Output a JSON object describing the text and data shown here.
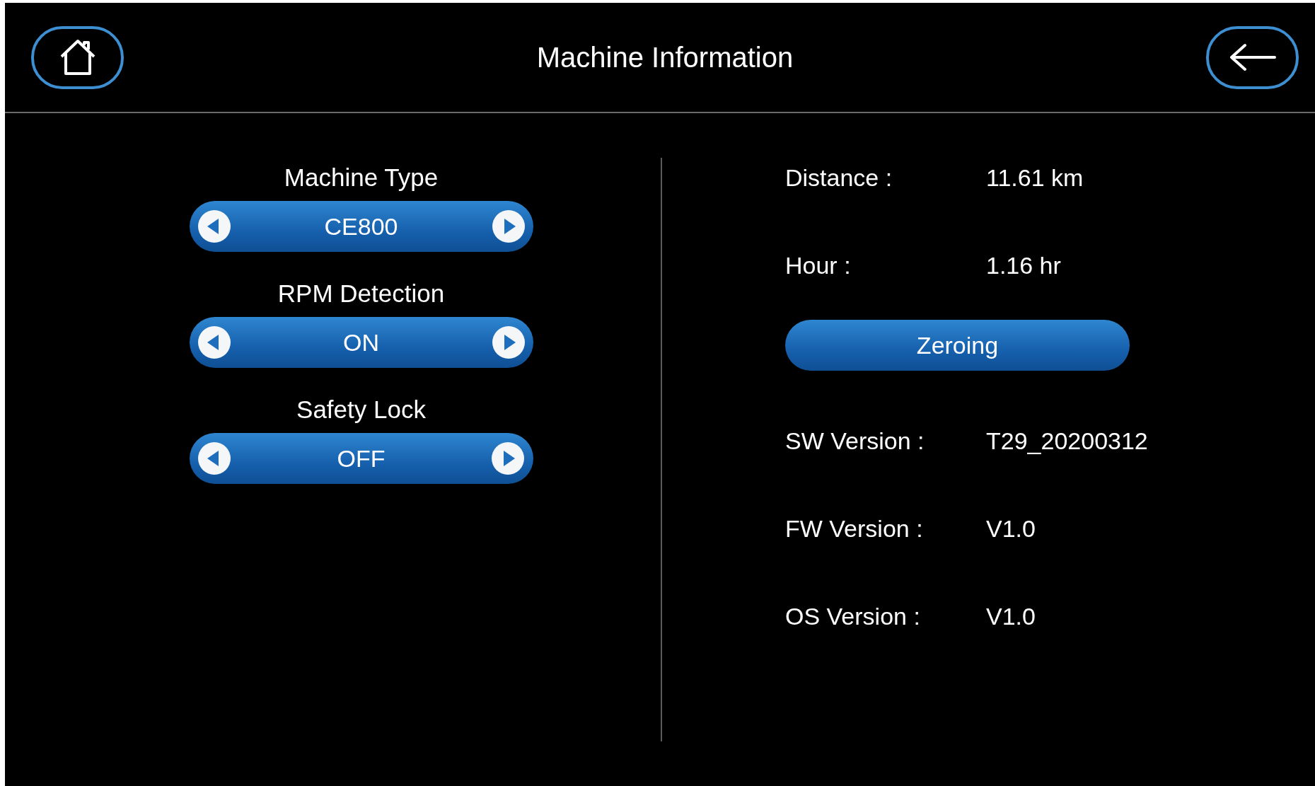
{
  "header": {
    "title": "Machine Information"
  },
  "settings": [
    {
      "label": "Machine Type",
      "value": "CE800"
    },
    {
      "label": "RPM Detection",
      "value": "ON"
    },
    {
      "label": "Safety Lock",
      "value": "OFF"
    }
  ],
  "info": [
    {
      "kind": "row",
      "label": "Distance :",
      "value": "11.61 km"
    },
    {
      "kind": "row",
      "label": "Hour :",
      "value": "1.16 hr"
    },
    {
      "kind": "button",
      "label": "Zeroing"
    },
    {
      "kind": "row",
      "label": "SW Version :",
      "value": "T29_20200312"
    },
    {
      "kind": "row",
      "label": "FW Version :",
      "value": "V1.0"
    },
    {
      "kind": "row",
      "label": "OS Version :",
      "value": "V1.0"
    }
  ]
}
